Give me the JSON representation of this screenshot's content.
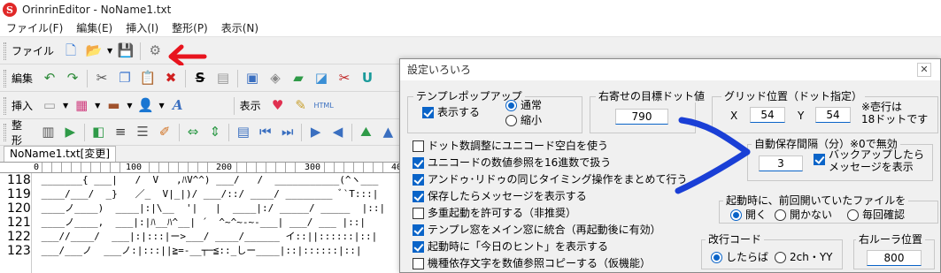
{
  "window": {
    "app_icon_letter": "S",
    "title": "OrinrinEditor - NoName1.txt"
  },
  "menu": [
    {
      "label": "ファイル(F)"
    },
    {
      "label": "編集(E)"
    },
    {
      "label": "挿入(I)"
    },
    {
      "label": "整形(P)"
    },
    {
      "label": "表示(N)"
    }
  ],
  "toolbars": {
    "file_label": "ファイル",
    "edit_label": "編集",
    "insert_label": "挿入",
    "view_label": "表示",
    "format_label": "整形"
  },
  "tab": {
    "label": "NoName1.txt[変更]"
  },
  "ruler": {
    "numbers": [
      "0",
      "100",
      "200",
      "300",
      "400"
    ]
  },
  "editor": {
    "lines": [
      {
        "num": "118",
        "text": " _______{ ___|   /  V   ,ﾊV^^) ___/   /  ___________(^ヽ___"
      },
      {
        "num": "119",
        "text": " ____/___/  _}   ／_  V|_|)/ ___/::/ ____/ ________ ﾞ`T:::|"
      },
      {
        "num": "120",
        "text": " ____ノ____)  ____|:|\\__  '|   |  ____|:/ _____/ _____  |::|"
      },
      {
        "num": "121",
        "text": " ____ノ____,  ___|:|ﾊ__ﾊ^__| ´  ^~^~-~-___| ___/ ___ |::|"
      },
      {
        "num": "122",
        "text": " ___//____/  ___|:|:::|ー>___/ ____/______ イ::||::::::|::|"
      },
      {
        "num": "123",
        "text": " ___/___ノ  ___ノ:|:::||≧=-__┬─≦::_しー____|::|::::::|::|"
      }
    ]
  },
  "dialog": {
    "title": "設定いろいろ",
    "close": "✕",
    "template_popup": {
      "title": "テンプレポップアップ",
      "show_label": "表示する",
      "show_checked": true,
      "normal_label": "通常",
      "small_label": "縮小",
      "selected": "通常"
    },
    "right_align": {
      "title": "右寄せの目標ドット値",
      "value": "790"
    },
    "grid": {
      "title": "グリッド位置（ドット指定）",
      "x_label": "X",
      "x_value": "54",
      "y_label": "Y",
      "y_value": "54",
      "note_line1": "※壱行は",
      "note_line2": "18ドットです"
    },
    "options": [
      {
        "label": "ドット数調整にユニコード空白を使う",
        "checked": false
      },
      {
        "label": "ユニコードの数値参照を16進数で扱う",
        "checked": true
      },
      {
        "label": "アンドゥ･リドゥの同じタイミング操作をまとめて行う",
        "checked": true
      },
      {
        "label": "保存したらメッセージを表示する",
        "checked": true
      },
      {
        "label": "多重起動を許可する（非推奨）",
        "checked": false
      },
      {
        "label": "テンプレ窓をメイン窓に統合（再起動後に有効）",
        "checked": true
      },
      {
        "label": "起動時に「今日のヒント」を表示する",
        "checked": true
      },
      {
        "label": "機種依存文字を数値参照コピーする（仮機能）",
        "checked": false
      }
    ],
    "autosave": {
      "title": "自動保存間隔（分）※0で無効",
      "value": "3",
      "backup_line1": "バックアップしたら",
      "backup_line2": "メッセージを表示",
      "backup_checked": true
    },
    "startup": {
      "title": "起動時に、前回開いていたファイルを",
      "options": [
        "開く",
        "開かない",
        "毎回確認"
      ],
      "selected": "開く"
    },
    "newline": {
      "title": "改行コード",
      "options": [
        "したらば",
        "2ch・YY"
      ],
      "selected": "したらば"
    },
    "right_ruler": {
      "title": "右ルーラ位置",
      "value": "800"
    }
  },
  "colors": {
    "accent": "#0a64c8",
    "annotation_red": "#e8141e",
    "annotation_blue": "#1a3fd6"
  }
}
